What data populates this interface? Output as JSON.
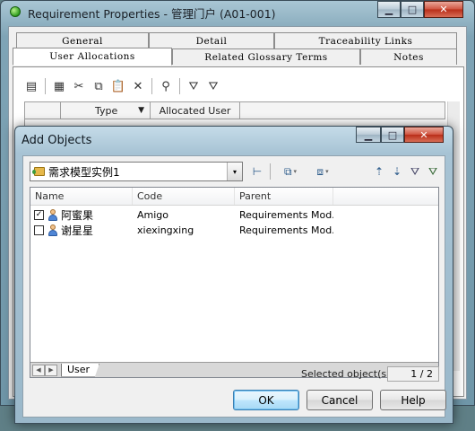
{
  "back_window": {
    "title": "Requirement Properties - 管理门户 (A01-001)",
    "caption": {
      "minimize": "▁",
      "maximize": "□",
      "close": "✕"
    },
    "tabs_top": [
      "General",
      "Detail",
      "Traceability Links"
    ],
    "tabs_bottom": [
      "User Allocations",
      "Related Glossary Terms",
      "Notes"
    ],
    "active_tab": "User Allocations",
    "toolbar_icons": [
      "properties-icon",
      "add-objects-icon",
      "cut-icon",
      "copy-icon",
      "paste-icon",
      "delete-icon",
      "find-icon",
      "filter-icon",
      "filter-clear-icon"
    ],
    "grid": {
      "headers": [
        "",
        "Type",
        "Allocated User"
      ],
      "type_sort_glyph": "▼"
    }
  },
  "dialog": {
    "title": "Add Objects",
    "caption": {
      "minimize": "▁",
      "maximize": "□",
      "close": "✕"
    },
    "model_select": {
      "value": "需求模型实例1",
      "arrow": "▾"
    },
    "toolbar_icons": [
      "tree-view-icon",
      "select-all-icon",
      "deselect-all-icon",
      "sort-asc-icon",
      "sort-desc-icon",
      "filter-icon",
      "filter-clear-icon"
    ],
    "columns": [
      "Name",
      "Code",
      "Parent"
    ],
    "rows": [
      {
        "checked": true,
        "check_glyph": "✓",
        "name": "阿蜜果",
        "code": "Amigo",
        "parent": "Requirements Mod..."
      },
      {
        "checked": false,
        "check_glyph": "",
        "name": "谢星星",
        "code": "xiexingxing",
        "parent": "Requirements Mod..."
      }
    ],
    "sheet_tab": "User",
    "nav": {
      "prev": "◀",
      "next": "▶"
    },
    "selected_label": "Selected object(s):",
    "selected_count": "1 / 2",
    "buttons": {
      "ok": "OK",
      "cancel": "Cancel",
      "help": "Help"
    }
  }
}
